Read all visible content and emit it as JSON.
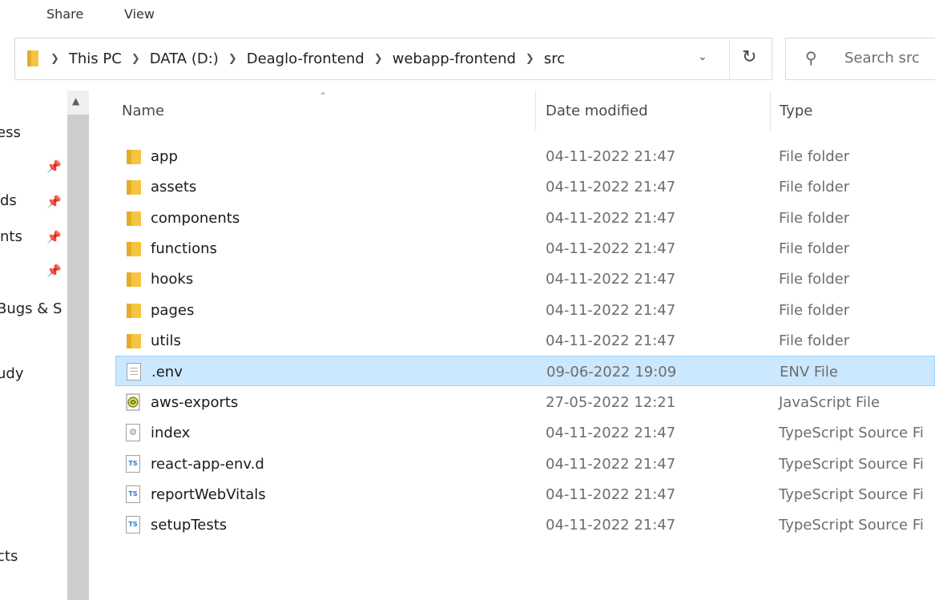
{
  "ribbon": {
    "tabs": [
      {
        "label": "Share"
      },
      {
        "label": "View"
      }
    ]
  },
  "address": {
    "crumbs": [
      "This PC",
      "DATA (D:)",
      "Deaglo-frontend",
      "webapp-frontend",
      "src"
    ],
    "dropdown_icon": "chevron-down-icon",
    "refresh_icon": "refresh-icon"
  },
  "search": {
    "placeholder": "Search src",
    "icon": "search-icon"
  },
  "nav": {
    "items": [
      {
        "label": "ess",
        "pinned": false
      },
      {
        "label": "",
        "pinned": true
      },
      {
        "label": "ds",
        "pinned": true
      },
      {
        "label": "nts",
        "pinned": true
      },
      {
        "label": "",
        "pinned": true
      },
      {
        "label": "Bugs & S",
        "pinned": false
      },
      {
        "label": "udy",
        "pinned": false
      },
      {
        "label": "cts",
        "pinned": false
      }
    ]
  },
  "columns": {
    "name": "Name",
    "date": "Date modified",
    "type": "Type"
  },
  "files": [
    {
      "name": "app",
      "date": "04-11-2022 21:47",
      "type": "File folder",
      "icon": "folder-icon",
      "selected": false
    },
    {
      "name": "assets",
      "date": "04-11-2022 21:47",
      "type": "File folder",
      "icon": "folder-icon",
      "selected": false
    },
    {
      "name": "components",
      "date": "04-11-2022 21:47",
      "type": "File folder",
      "icon": "folder-icon",
      "selected": false
    },
    {
      "name": "functions",
      "date": "04-11-2022 21:47",
      "type": "File folder",
      "icon": "folder-icon",
      "selected": false
    },
    {
      "name": "hooks",
      "date": "04-11-2022 21:47",
      "type": "File folder",
      "icon": "folder-icon",
      "selected": false
    },
    {
      "name": "pages",
      "date": "04-11-2022 21:47",
      "type": "File folder",
      "icon": "folder-icon",
      "selected": false
    },
    {
      "name": "utils",
      "date": "04-11-2022 21:47",
      "type": "File folder",
      "icon": "folder-icon",
      "selected": false
    },
    {
      "name": ".env",
      "date": "09-06-2022 19:09",
      "type": "ENV File",
      "icon": "document-icon",
      "selected": true
    },
    {
      "name": "aws-exports",
      "date": "27-05-2022 12:21",
      "type": "JavaScript File",
      "icon": "javascript-file-icon",
      "selected": false
    },
    {
      "name": "index",
      "date": "04-11-2022 21:47",
      "type": "TypeScript Source Fi",
      "icon": "typescript-config-icon",
      "selected": false
    },
    {
      "name": "react-app-env.d",
      "date": "04-11-2022 21:47",
      "type": "TypeScript Source Fi",
      "icon": "typescript-file-icon",
      "selected": false
    },
    {
      "name": "reportWebVitals",
      "date": "04-11-2022 21:47",
      "type": "TypeScript Source Fi",
      "icon": "typescript-file-icon",
      "selected": false
    },
    {
      "name": "setupTests",
      "date": "04-11-2022 21:47",
      "type": "TypeScript Source Fi",
      "icon": "typescript-file-icon",
      "selected": false
    }
  ],
  "colors": {
    "selection_bg": "#cce8ff",
    "selection_border": "#99d1ff",
    "folder_yellow": "#f5c542"
  }
}
